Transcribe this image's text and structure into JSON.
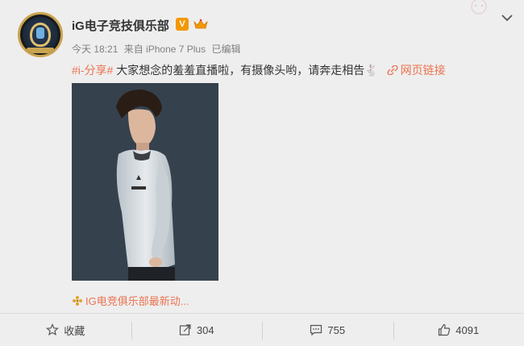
{
  "post": {
    "username": "iG电子竞技俱乐部",
    "vip_badge": "V",
    "time": "今天 18:21",
    "source": "来自 iPhone 7 Plus",
    "edited": "已编辑",
    "hashtag": "#i-分享#",
    "content": " 大家想念的羞羞直播啦，有摄像头哟，请奔走相告",
    "emoji": "🐇",
    "link_label": "网页链接",
    "source_link": "IG电竞俱乐部最新动..."
  },
  "actions": {
    "favorite_label": "收藏",
    "repost_count": "304",
    "comment_count": "755",
    "like_count": "4091"
  },
  "colors": {
    "accent": "#eb7350",
    "vip": "#f39800",
    "background": "#eeeeee"
  },
  "icons": [
    "dropdown-icon",
    "crown-icon",
    "link-icon",
    "star-icon",
    "repost-icon",
    "comment-icon",
    "thumb-up-icon",
    "flower-icon"
  ]
}
